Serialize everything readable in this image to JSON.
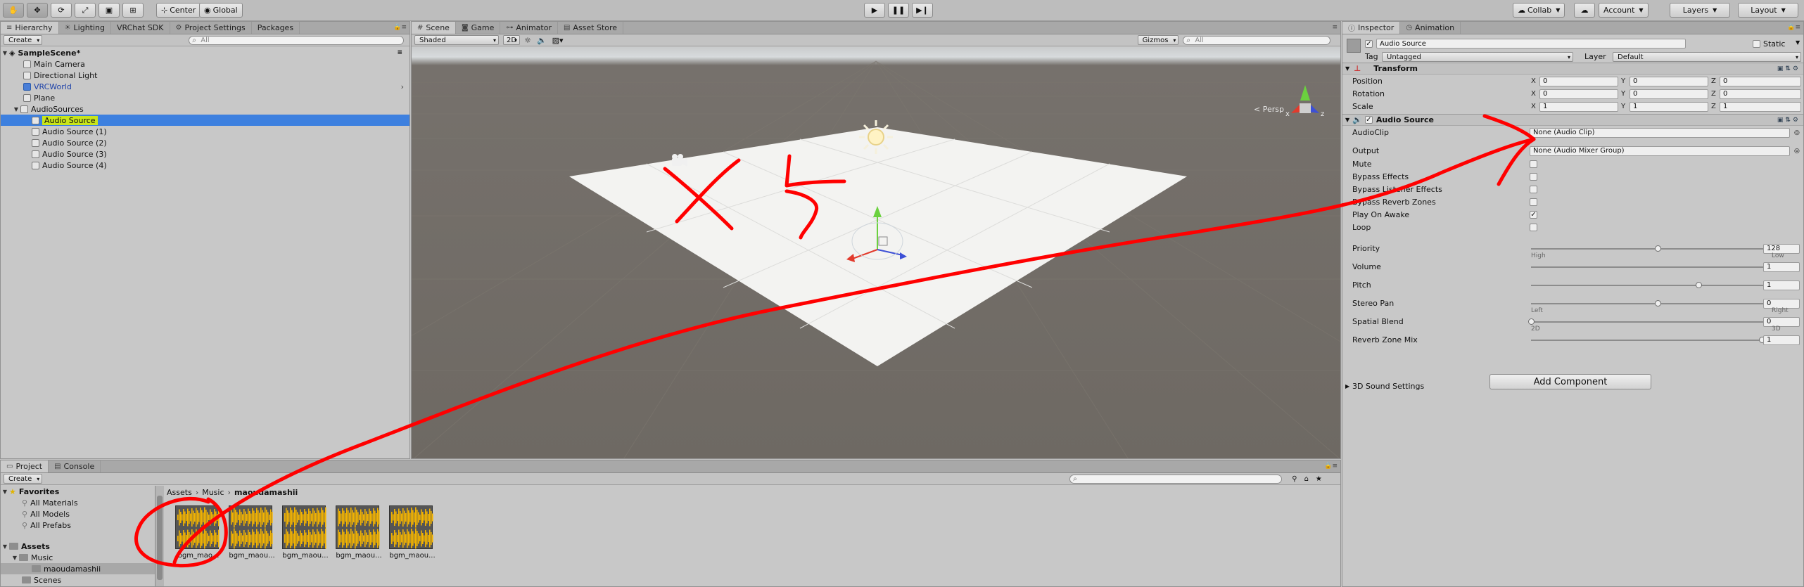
{
  "toolbar": {
    "pivot": "Center",
    "space": "Global",
    "collab": "Collab",
    "account": "Account",
    "layers": "Layers",
    "layout": "Layout"
  },
  "hierarchy": {
    "tab": "Hierarchy",
    "other_tabs": [
      "Lighting",
      "VRChat SDK",
      "Project Settings",
      "Packages"
    ],
    "create": "Create",
    "search_placeholder": "All",
    "scene": "SampleScene*",
    "items": [
      {
        "label": "Main Camera"
      },
      {
        "label": "Directional Light"
      },
      {
        "label": "VRCWorld"
      },
      {
        "label": "Plane"
      },
      {
        "label": "AudioSources"
      },
      {
        "label": "Audio Source"
      },
      {
        "label": "Audio Source (1)"
      },
      {
        "label": "Audio Source (2)"
      },
      {
        "label": "Audio Source (3)"
      },
      {
        "label": "Audio Source (4)"
      }
    ]
  },
  "scene_view": {
    "tabs": [
      "Scene",
      "Game",
      "Animator",
      "Asset Store"
    ],
    "shading": "Shaded",
    "mode_2d": "2D",
    "gizmos": "Gizmos",
    "search_placeholder": "All",
    "persp": "< Persp",
    "gizmo_axes": {
      "x": "x",
      "z": "z"
    }
  },
  "inspector": {
    "tabs": [
      "Inspector",
      "Animation"
    ],
    "object_name": "Audio Source",
    "static": "Static",
    "tag_label": "Tag",
    "tag": "Untagged",
    "layer_label": "Layer",
    "layer": "Default",
    "transform": {
      "title": "Transform",
      "rows": [
        {
          "label": "Position",
          "x": "0",
          "y": "0",
          "z": "0"
        },
        {
          "label": "Rotation",
          "x": "0",
          "y": "0",
          "z": "0"
        },
        {
          "label": "Scale",
          "x": "1",
          "y": "1",
          "z": "1"
        }
      ]
    },
    "audio_source": {
      "title": "Audio Source",
      "audio_clip_label": "AudioClip",
      "audio_clip": "None (Audio Clip)",
      "output_label": "Output",
      "output": "None (Audio Mixer Group)",
      "toggles": [
        {
          "label": "Mute",
          "checked": false
        },
        {
          "label": "Bypass Effects",
          "checked": false
        },
        {
          "label": "Bypass Listener Effects",
          "checked": false
        },
        {
          "label": "Bypass Reverb Zones",
          "checked": false
        },
        {
          "label": "Play On Awake",
          "checked": true
        },
        {
          "label": "Loop",
          "checked": false
        }
      ],
      "sliders": [
        {
          "label": "Priority",
          "value": "128",
          "fraction": 0.5,
          "left": "High",
          "right": "Low"
        },
        {
          "label": "Volume",
          "value": "1",
          "fraction": 1.0
        },
        {
          "label": "Pitch",
          "value": "1",
          "fraction": 0.66
        },
        {
          "label": "Stereo Pan",
          "value": "0",
          "fraction": 0.5,
          "left": "Left",
          "right": "Right"
        },
        {
          "label": "Spatial Blend",
          "value": "0",
          "fraction": 0.0,
          "left": "2D",
          "right": "3D"
        },
        {
          "label": "Reverb Zone Mix",
          "value": "1",
          "fraction": 0.91
        }
      ],
      "sound_settings": "3D Sound Settings"
    },
    "add_component": "Add Component"
  },
  "project": {
    "tabs": [
      "Project",
      "Console"
    ],
    "create": "Create",
    "tree": [
      {
        "label": "Favorites",
        "bold": true
      },
      {
        "label": "All Materials"
      },
      {
        "label": "All Models"
      },
      {
        "label": "All Prefabs"
      },
      {
        "label": "Assets",
        "bold": true
      },
      {
        "label": "Music"
      },
      {
        "label": "maoudamashii"
      },
      {
        "label": "Scenes"
      }
    ],
    "breadcrumb": [
      "Assets",
      "Music",
      "maoudamashii"
    ],
    "assets": [
      "bgm_mao...",
      "bgm_maou...",
      "bgm_maou...",
      "bgm_maou...",
      "bgm_maou..."
    ]
  },
  "colors": {
    "selection": "#3d80df",
    "annotation": "#ff0000",
    "asset_wave": "#f4b400"
  }
}
